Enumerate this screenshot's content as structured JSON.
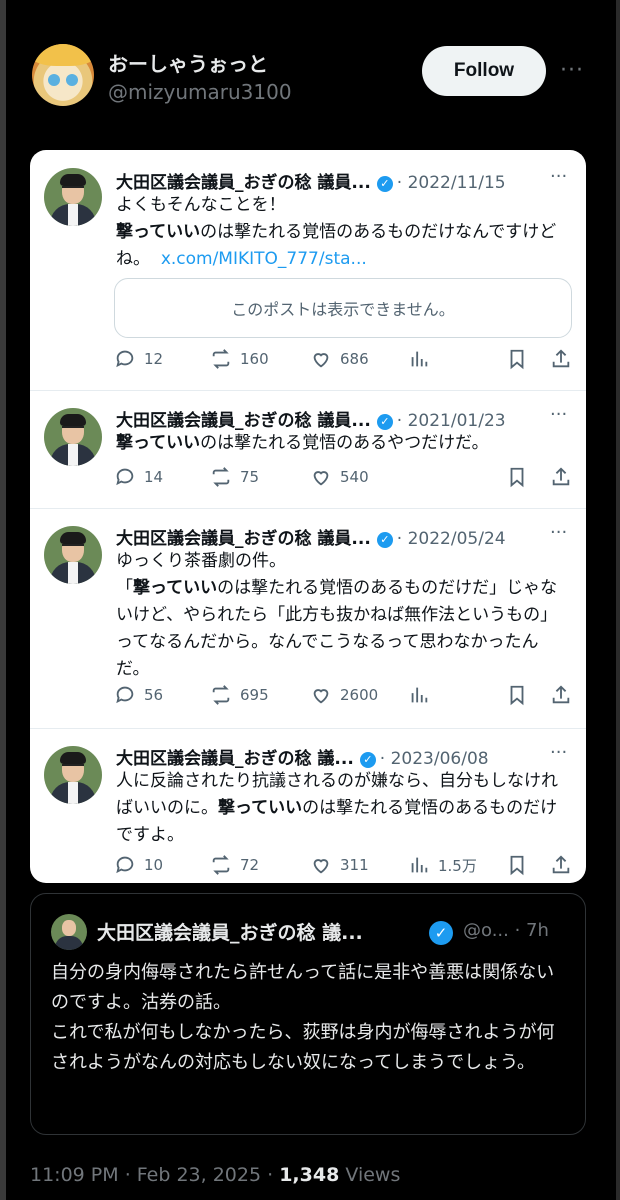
{
  "header": {
    "display_name": "おーしゃうぉっと",
    "handle": "@mizyumaru3100",
    "follow_label": "Follow",
    "more_label": "···"
  },
  "embedded_tweets": [
    {
      "author": "大田区議会議員_おぎの稔 議員...",
      "date": "2022/11/15",
      "text_lines": [
        "よくもそんなことを！"
      ],
      "bold_prefix": "撃っていい",
      "text_after_bold": "のは撃たれる覚悟のあるものだけなんですけどね。",
      "link": "x.com/MIKITO_777/sta...",
      "quoted_unavailable": "このポストは表示できません。",
      "replies": "12",
      "reposts": "160",
      "likes": "686",
      "views": ""
    },
    {
      "author": "大田区議会議員_おぎの稔 議員...",
      "date": "2021/01/23",
      "bold_prefix": "撃っていい",
      "text_after_bold": "のは撃たれる覚悟のあるやつだけだ。",
      "replies": "14",
      "reposts": "75",
      "likes": "540",
      "views": ""
    },
    {
      "author": "大田区議会議員_おぎの稔 議員...",
      "date": "2022/05/24",
      "line1": "ゆっくり茶番劇の件。",
      "pre_bold": "「",
      "bold_prefix": "撃っていい",
      "text_after_bold": "のは撃たれる覚悟のあるものだけだ」じゃないけど、やられたら「此方も抜かねば無作法というもの」ってなるんだから。なんでこうなるって思わなかったんだ。",
      "replies": "56",
      "reposts": "695",
      "likes": "2600",
      "views": ""
    },
    {
      "author": "大田区議会議員_おぎの稔 議...",
      "date": "2023/06/08",
      "pre_bold": "人に反論されたり抗議されるのが嫌なら、自分もしなければいいのに。",
      "bold_prefix": "撃っていい",
      "text_after_bold": "のは撃たれる覚悟のあるものだけですよ。",
      "replies": "10",
      "reposts": "72",
      "likes": "311",
      "views": "1.5万"
    }
  ],
  "quote_tweet": {
    "author": "大田区議会議員_おぎの稔 議...",
    "handle_truncated": "@o...",
    "age": "7h",
    "text": "自分の身内侮辱されたら許せんって話に是非や善悪は関係ないのですよ。沽券の話。\nこれで私が何もしなかったら、荻野は身内が侮辱されようが何されようがなんの対応もしない奴になってしまうでしょう。"
  },
  "footer": {
    "time": "11:09 PM",
    "date": "Feb 23, 2025",
    "views_count": "1,348",
    "views_label": "Views"
  },
  "icons": [
    "reply-icon",
    "repost-icon",
    "like-icon",
    "views-icon",
    "bookmark-icon",
    "share-icon",
    "verified-icon",
    "more-icon"
  ],
  "colors": {
    "accent": "#1d9bf0",
    "background": "#000000",
    "card": "#ffffff",
    "muted": "#71767b"
  }
}
